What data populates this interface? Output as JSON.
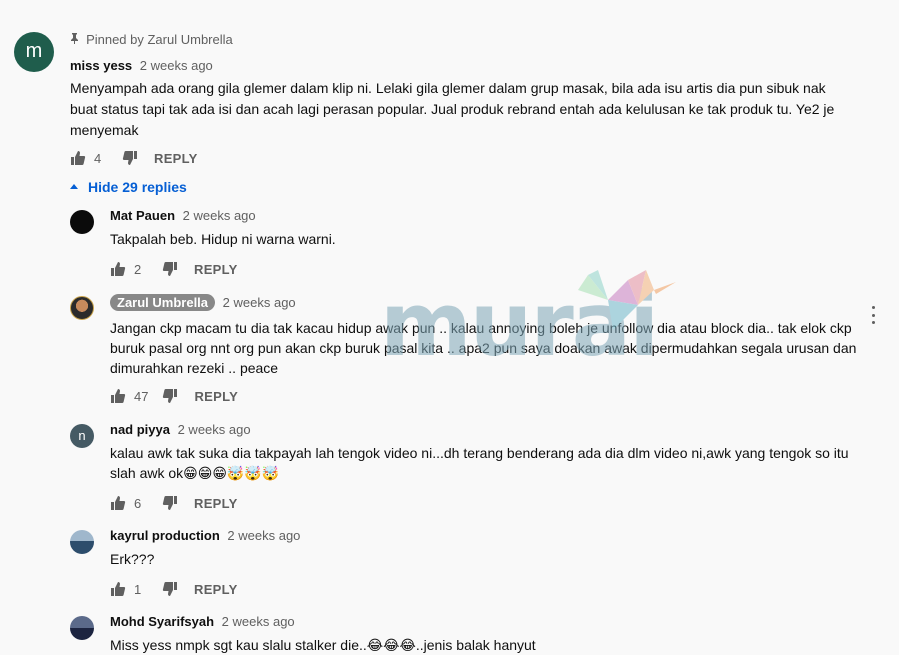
{
  "top_comment": {
    "avatar_letter": "m",
    "pinned_label": "Pinned by Zarul Umbrella",
    "author": "miss yess",
    "time": "2 weeks ago",
    "text": "Menyampah ada orang gila glemer dalam klip ni. Lelaki gila glemer dalam grup masak, bila ada isu artis dia pun sibuk nak buat status tapi tak ada isi dan acah lagi perasan popular. Jual produk rebrand entah ada kelulusan ke tak produk tu. Ye2 je menyemak",
    "likes": "4",
    "reply_label": "REPLY",
    "hide_replies_label": "Hide 29 replies"
  },
  "replies": [
    {
      "author": "Mat Pauen",
      "time": "2 weeks ago",
      "text": "Takpalah beb. Hidup ni warna warni.",
      "likes": "2",
      "reply_label": "REPLY"
    },
    {
      "author": "Zarul Umbrella",
      "time": "2 weeks ago",
      "text": "Jangan ckp macam tu dia tak kacau hidup awak pun .. kalau annoying boleh je unfollow dia atau block dia.. tak elok ckp buruk pasal org nnt org pun akan ckp buruk pasal kita .. apa2 pun saya doakan awak dipermudahkan segala urusan dan dimurahkan rezeki .. peace",
      "likes": "47",
      "reply_label": "REPLY"
    },
    {
      "author": "nad piyya",
      "avatar_letter": "n",
      "time": "2 weeks ago",
      "text": "kalau awk tak suka dia takpayah lah tengok video ni...dh terang benderang ada dia dlm video ni,awk yang tengok so itu slah awk ok😁😁😁🤯🤯🤯",
      "likes": "6",
      "reply_label": "REPLY"
    },
    {
      "author": "kayrul production",
      "time": "2 weeks ago",
      "text": "Erk???",
      "likes": "1",
      "reply_label": "REPLY"
    },
    {
      "author": "Mohd Syarifsyah",
      "time": "2 weeks ago",
      "text": "Miss yess nmpk sgt kau slalu stalker die..😂😂😂..jenis balak hanyut"
    }
  ],
  "watermark": {
    "text": "murai"
  },
  "icons": {
    "like": "thumbs-up-icon",
    "dislike": "thumbs-down-icon",
    "pin": "pin-icon",
    "more": "more-vert-icon",
    "caret": "caret-up-icon"
  },
  "colors": {
    "background": "#f9f9f9",
    "link_blue": "#065fd4",
    "muted": "#606060",
    "owner_chip": "#888888"
  }
}
